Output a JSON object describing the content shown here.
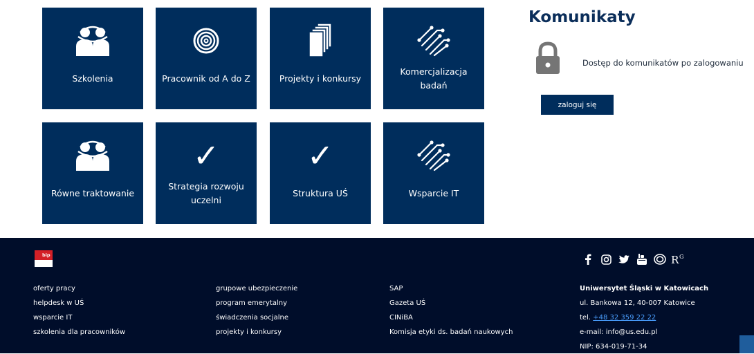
{
  "tiles": [
    {
      "label": "Szkolenia",
      "icon": "people-icon"
    },
    {
      "label": "Pracownik od A do Z",
      "icon": "spiral-icon"
    },
    {
      "label": "Projekty i konkursy",
      "icon": "documents-icon"
    },
    {
      "label": "Komercjalizacja badań",
      "icon": "circuit-icon"
    },
    {
      "label": "Równe traktowanie",
      "icon": "people-icon"
    },
    {
      "label": "Strategia rozwoju uczelni",
      "icon": "checkmark-icon",
      "glyph": "✓"
    },
    {
      "label": "Struktura UŚ",
      "icon": "checkmark-icon",
      "glyph": "✓"
    },
    {
      "label": "Wsparcie IT",
      "icon": "circuit-icon"
    }
  ],
  "komunikaty": {
    "title": "Komunikaty",
    "message": "Dostęp do komunikatów po zalogowaniu",
    "login_label": "zaloguj się"
  },
  "footer": {
    "bip_label": "bip",
    "col1": [
      "oferty pracy",
      "helpdesk w UŚ",
      "wsparcie IT",
      "szkolenia dla pracowników"
    ],
    "col2": [
      "grupowe ubezpieczenie",
      "program emerytalny",
      "świadczenia socjalne",
      "projekty i konkursy"
    ],
    "col3": [
      "SAP",
      "Gazeta UŚ",
      "CINiBA",
      "Komisja etyki ds. badań naukowych"
    ],
    "social": [
      "facebook-icon",
      "instagram-icon",
      "twitter-icon",
      "youtube-icon",
      "orcid-icon",
      "researchgate-icon"
    ],
    "researchgate_text": "RG",
    "contact": {
      "name": "Uniwersytet Śląski w Katowicach",
      "address": "ul. Bankowa 12, 40-007 Katowice",
      "phone_prefix": "tel. ",
      "phone": "+48 32 359 22 22",
      "email": "e-mail: info@us.edu.pl",
      "nip": "NIP: 634-019-71-34"
    }
  },
  "colors": {
    "tile": "#002d5c",
    "footer": "#000d2a",
    "accent_link": "#4a9fff",
    "bip_red": "#d42027"
  }
}
